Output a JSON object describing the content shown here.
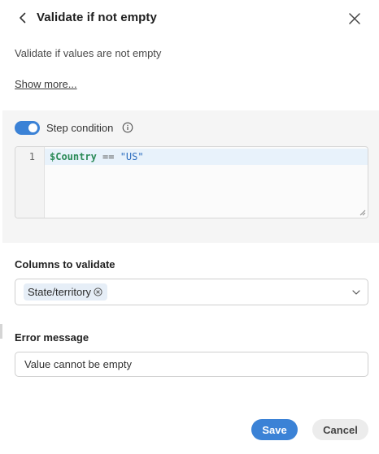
{
  "header": {
    "title": "Validate if not empty"
  },
  "description": "Validate if values are not empty",
  "show_more_label": "Show more...",
  "step_condition": {
    "enabled": true,
    "label": "Step condition",
    "code": {
      "line_number": "1",
      "variable": "$Country",
      "operator": " == ",
      "value": "\"US\""
    }
  },
  "columns": {
    "label": "Columns to validate",
    "selected": [
      "State/territory"
    ]
  },
  "error_message": {
    "label": "Error message",
    "value": "Value cannot be empty"
  },
  "footer": {
    "save_label": "Save",
    "cancel_label": "Cancel"
  },
  "colors": {
    "accent": "#3b82d6",
    "chip_bg": "#e6eef7",
    "section_bg": "#f5f5f5"
  }
}
